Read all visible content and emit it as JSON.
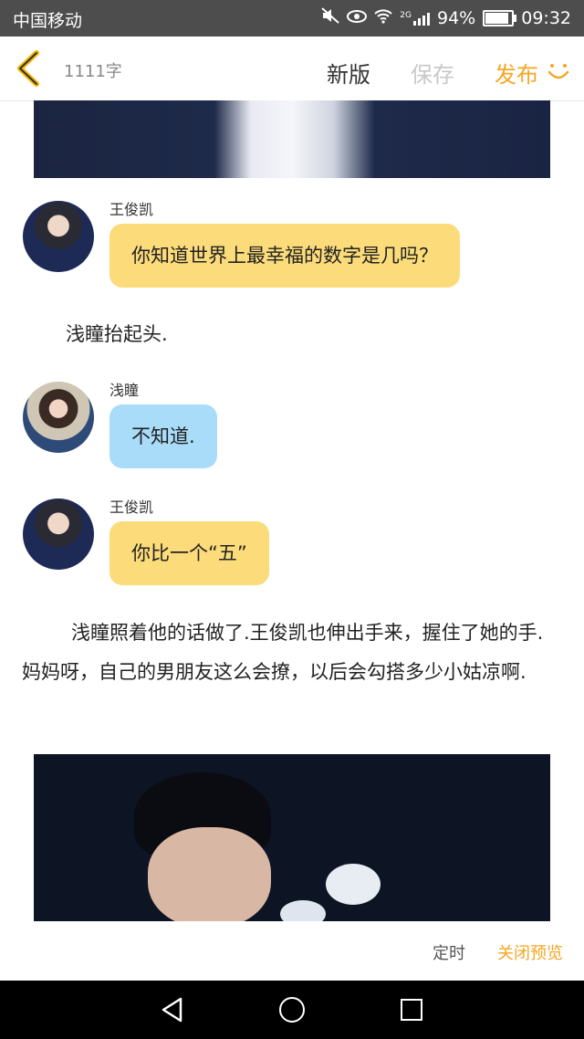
{
  "status_bar": {
    "carrier": "中国移动",
    "network_label": "2G",
    "battery": "94%",
    "battery_level": 0.94,
    "time": "09:32"
  },
  "header": {
    "word_count": "1111字",
    "new_version": "新版",
    "save": "保存",
    "publish": "发布"
  },
  "chat": {
    "msg1": {
      "sender": "王俊凯",
      "text": "你知道世界上最幸福的数字是几吗？"
    },
    "narration1": "浅瞳抬起头.",
    "msg2": {
      "sender": "浅瞳",
      "text": "不知道."
    },
    "msg3": {
      "sender": "王俊凯",
      "text": "你比一个“五”"
    },
    "paragraph": "浅瞳照着他的话做了.王俊凯也伸出手来，握住了她的手.妈妈呀，自己的男朋友这么会撩，以后会勾搭多少小姑凉啊."
  },
  "footer": {
    "timer": "定时",
    "close_preview": "关闭预览"
  },
  "colors": {
    "accent": "#f5a623",
    "bubble_yellow": "#fcdc7a",
    "bubble_blue": "#a8dcf8"
  },
  "icons": [
    "back-chevron-icon",
    "smile-icon",
    "mute-icon",
    "eye-icon",
    "wifi-icon",
    "signal-icon",
    "battery-icon",
    "nav-back-icon",
    "nav-home-icon",
    "nav-recent-icon"
  ]
}
